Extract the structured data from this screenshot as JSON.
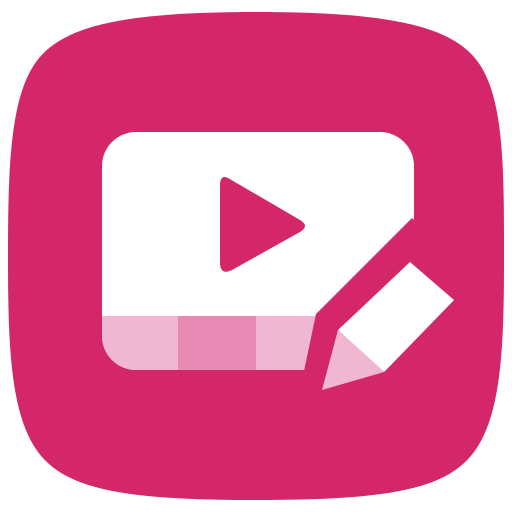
{
  "icon": {
    "name": "video-editor-app-icon",
    "background_color": "#D4276A",
    "foreground_color": "#FFFFFF",
    "timeline_colors": [
      "#F0B7D0",
      "#E98AB5",
      "#F0B7D0"
    ],
    "play_triangle_color": "#D4276A",
    "pencil_tip_color": "#F0B7D0"
  }
}
